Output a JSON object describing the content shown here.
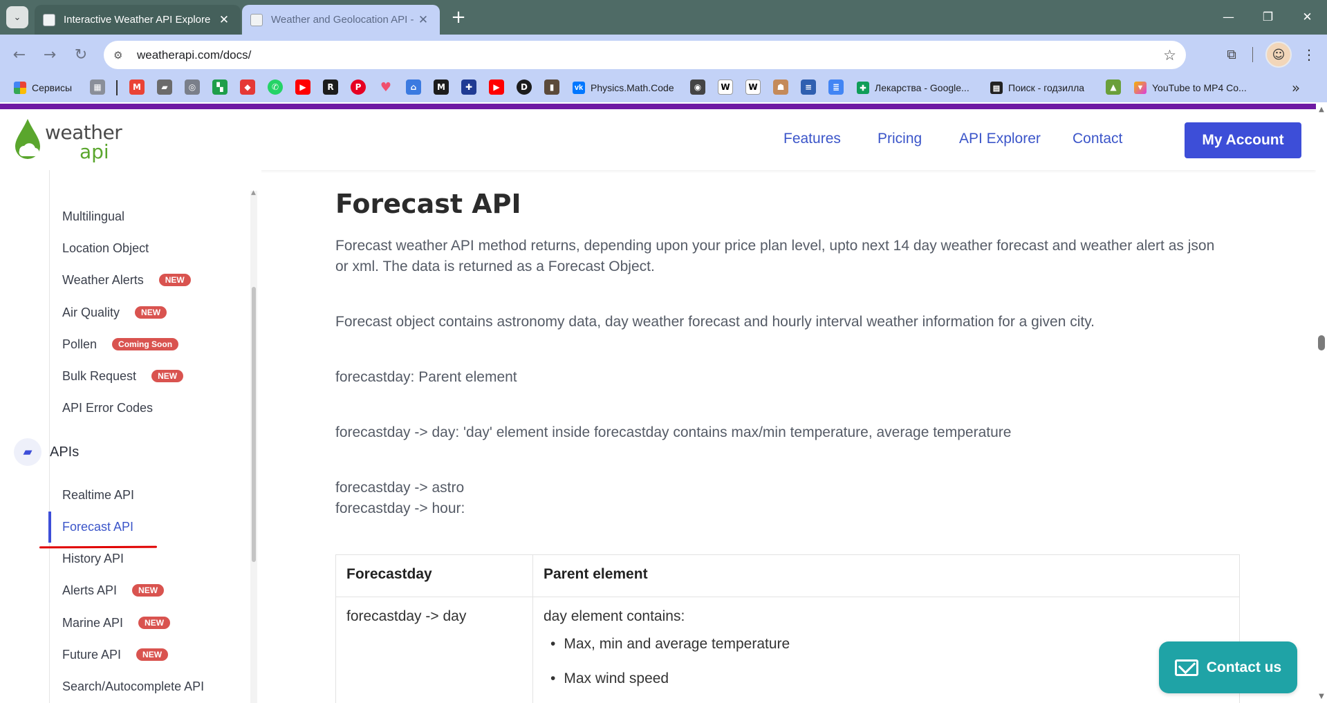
{
  "browser": {
    "tabs": [
      {
        "title": "Interactive Weather API Explore",
        "active": false
      },
      {
        "title": "Weather and Geolocation API -",
        "active": true
      }
    ],
    "url": "weatherapi.com/docs/",
    "bookmarks": [
      {
        "label": "Сервисы"
      },
      {
        "label": "Physics.Math.Code"
      },
      {
        "label": "Лекарства - Google..."
      },
      {
        "label": "Поиск - годзилла"
      },
      {
        "label": "YouTube to MP4 Co..."
      }
    ],
    "accent_color": "#c3d2f7"
  },
  "site": {
    "logo": {
      "word1": "weather",
      "word2": "api"
    },
    "nav": [
      "Features",
      "Pricing",
      "API Explorer",
      "Contact"
    ],
    "account_button": "My Account",
    "brand_color": "#3d4ed8"
  },
  "sidebar": {
    "items_top": [
      {
        "label": "Multilingual",
        "badge": ""
      },
      {
        "label": "Location Object",
        "badge": ""
      },
      {
        "label": "Weather Alerts",
        "badge": "NEW"
      },
      {
        "label": "Air Quality",
        "badge": "NEW"
      },
      {
        "label": "Pollen",
        "badge": "Coming Soon"
      },
      {
        "label": "Bulk Request",
        "badge": "NEW"
      },
      {
        "label": "API Error Codes",
        "badge": ""
      }
    ],
    "section": "APIs",
    "items_apis": [
      {
        "label": "Realtime API",
        "badge": ""
      },
      {
        "label": "Forecast API",
        "badge": "",
        "active": true
      },
      {
        "label": "History API",
        "badge": ""
      },
      {
        "label": "Alerts API",
        "badge": "NEW"
      },
      {
        "label": "Marine API",
        "badge": "NEW"
      },
      {
        "label": "Future API",
        "badge": "NEW"
      },
      {
        "label": "Search/Autocomplete API",
        "badge": ""
      }
    ]
  },
  "main": {
    "title": "Forecast API",
    "paragraphs": [
      "Forecast weather API method returns, depending upon your price plan level, upto next 14 day weather forecast and weather alert as json or xml. The data is returned as a Forecast Object.",
      "Forecast object contains astronomy data, day weather forecast and hourly interval weather information for a given city.",
      "forecastday: Parent element",
      "forecastday -> day: 'day' element inside forecastday contains max/min temperature, average temperature",
      "forecastday -> astro",
      "forecastday -> hour:"
    ],
    "table": {
      "headers": [
        "Forecastday",
        "Parent element"
      ],
      "rows": [
        {
          "key": "forecastday -> day",
          "desc": "day element contains:",
          "bullets": [
            "Max, min and average temperature",
            "Max wind speed"
          ]
        }
      ]
    }
  },
  "contact_button": "Contact us"
}
